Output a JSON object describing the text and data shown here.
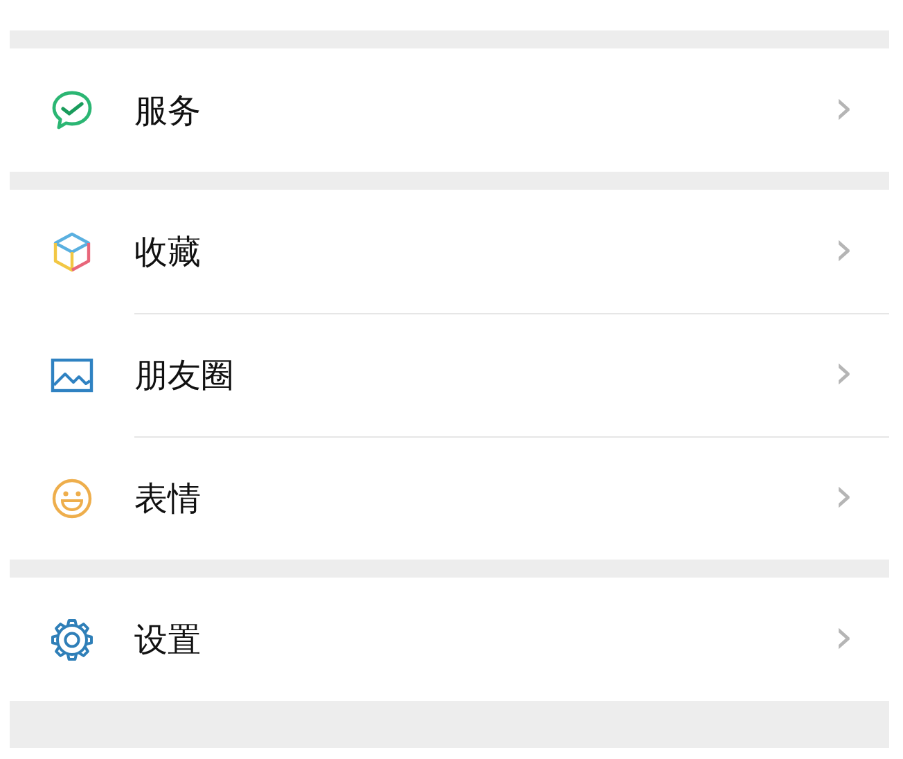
{
  "groups": [
    {
      "items": [
        {
          "kind": "service",
          "label": "服务",
          "chevron": "›"
        }
      ]
    },
    {
      "items": [
        {
          "kind": "favorites",
          "label": "收藏",
          "chevron": "›"
        },
        {
          "kind": "moments",
          "label": "朋友圈",
          "chevron": "›"
        },
        {
          "kind": "stickers",
          "label": "表情",
          "chevron": "›"
        }
      ]
    },
    {
      "items": [
        {
          "kind": "settings",
          "label": "设置",
          "chevron": "›"
        }
      ]
    }
  ]
}
